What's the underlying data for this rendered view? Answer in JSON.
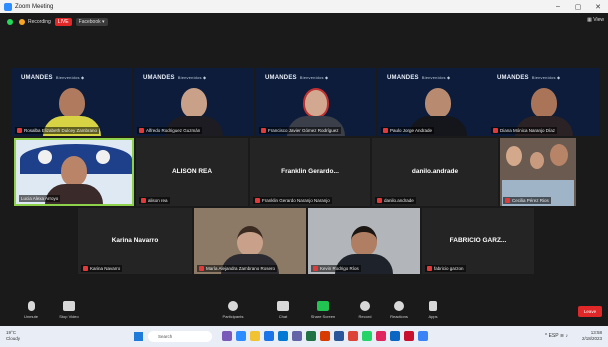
{
  "window": {
    "title": "Zoom Meeting"
  },
  "topbar": {
    "recording_label": "Recording",
    "live_label": "LIVE",
    "facebook_label": "Facebook ▾",
    "view_label": "▦ View"
  },
  "tiles": [
    {
      "bg": "UMANDES",
      "name": "Rosalba Elizabeth Dulcey Zambrano"
    },
    {
      "bg": "UMANDES",
      "name": "Alfredo Rodriguez Guzmán"
    },
    {
      "bg": "UMANDES",
      "name": "Francisco Javier Gómez Rodríguez"
    },
    {
      "bg": "UMANDES",
      "name": "Paulo Jorge Andrade"
    },
    {
      "bg": "UMANDES",
      "name": "Diana Mónica Naranjo Díaz"
    },
    {
      "name": "Lucia Alexa Arroyo"
    },
    {
      "center": "ALISON REA",
      "name": "alison rea"
    },
    {
      "center": "Franklin Gerardo...",
      "name": "Franklin Gerardo Naranjo Naranjo"
    },
    {
      "center": "danilo.andrade",
      "name": "danilo.andrade"
    },
    {
      "name": "Cecilia Pérez Rios"
    },
    {
      "center": "Karina Navarro",
      "name": "Karina Navarro"
    },
    {
      "name": "María Alejandra Zambrano Rosero"
    },
    {
      "name": "Kevin Rodrigo Ríos"
    },
    {
      "center": "FABRICIO GARZ...",
      "name": "fabricio garzon"
    }
  ],
  "toolbar": {
    "items": [
      {
        "label": "Unmute"
      },
      {
        "label": "Stop Video"
      },
      {
        "label": "Participants"
      },
      {
        "label": "Chat"
      },
      {
        "label": "Share Screen"
      },
      {
        "label": "Record"
      },
      {
        "label": "Reactions"
      },
      {
        "label": "Apps"
      }
    ],
    "leave_label": "Leave"
  },
  "taskbar": {
    "weather_temp": "19°C",
    "weather_desc": "Cloudy",
    "search_placeholder": "Search",
    "time": "13:58",
    "date": "2/18/2023",
    "lang": "ESP"
  },
  "colors": {
    "accent": "#2d8cff",
    "danger": "#e02828",
    "active_speaker": "#8ed14a"
  }
}
